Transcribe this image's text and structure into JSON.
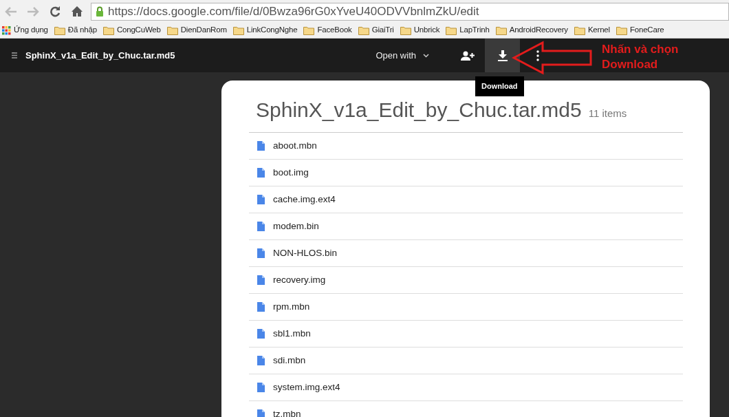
{
  "browser": {
    "url": "https://docs.google.com/file/d/0Bwza96rG0xYveU40ODVVbnlmZkU/edit",
    "bookmarks": [
      {
        "label": "Ứng dụng",
        "kind": "apps"
      },
      {
        "label": "Đã nhập",
        "kind": "folder"
      },
      {
        "label": "CongCuWeb",
        "kind": "folder"
      },
      {
        "label": "DienDanRom",
        "kind": "folder"
      },
      {
        "label": "LinkCongNghe",
        "kind": "folder"
      },
      {
        "label": "FaceBook",
        "kind": "folder"
      },
      {
        "label": "GiaiTri",
        "kind": "folder"
      },
      {
        "label": "Unbrick",
        "kind": "folder"
      },
      {
        "label": "LapTrinh",
        "kind": "folder"
      },
      {
        "label": "AndroidRecovery",
        "kind": "folder"
      },
      {
        "label": "Kernel",
        "kind": "folder"
      },
      {
        "label": "FoneCare",
        "kind": "folder"
      }
    ]
  },
  "header": {
    "title": "SphinX_v1a_Edit_by_Chuc.tar.md5",
    "open_with": "Open with",
    "tooltip": "Download"
  },
  "annotation": {
    "text": "Nhấn và chọn Download"
  },
  "folder": {
    "title": "SphinX_v1a_Edit_by_Chuc.tar.md5",
    "count": "11 items",
    "files": [
      "aboot.mbn",
      "boot.img",
      "cache.img.ext4",
      "modem.bin",
      "NON-HLOS.bin",
      "recovery.img",
      "rpm.mbn",
      "sbl1.mbn",
      "sdi.mbn",
      "system.img.ext4",
      "tz.mbn"
    ]
  }
}
